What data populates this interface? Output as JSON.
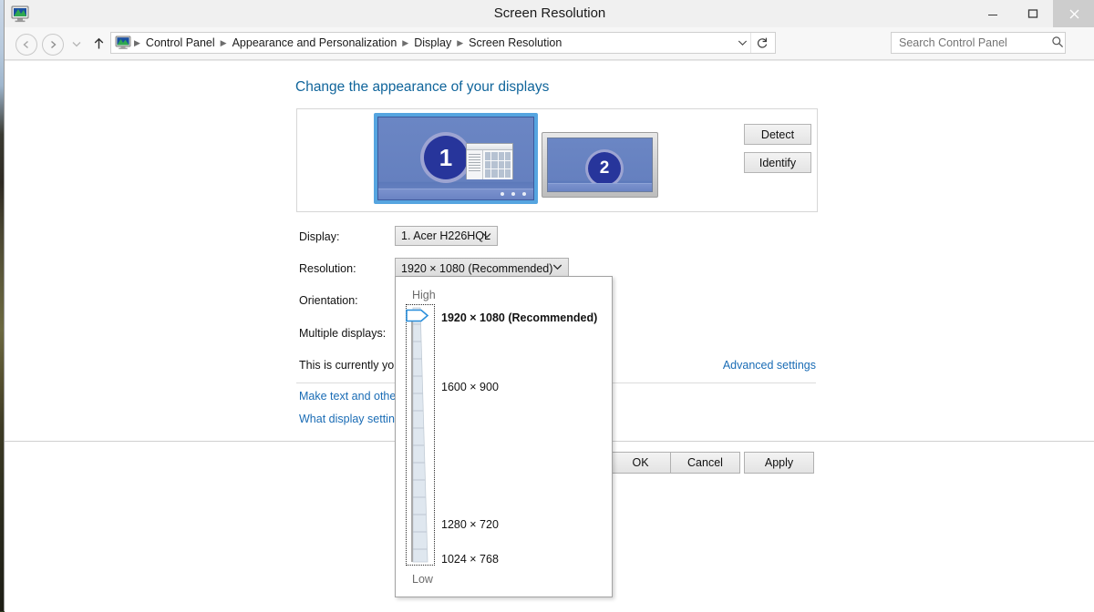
{
  "window": {
    "title": "Screen Resolution",
    "icon": "display-monitor-icon",
    "minimize_label": "Minimize",
    "maximize_label": "Maximize",
    "close_label": "Close"
  },
  "nav": {
    "back_label": "Back",
    "forward_label": "Forward",
    "recent_label": "Recent locations",
    "up_label": "Up one level",
    "breadcrumbs": [
      "Control Panel",
      "Appearance and Personalization",
      "Display",
      "Screen Resolution"
    ],
    "dropdown_label": "Previous locations",
    "refresh_label": "Refresh"
  },
  "search": {
    "placeholder": "Search Control Panel",
    "value": ""
  },
  "main": {
    "heading": "Change the appearance of your displays",
    "monitors": [
      {
        "number": "1",
        "selected": true
      },
      {
        "number": "2",
        "selected": false
      }
    ],
    "detect_label": "Detect",
    "identify_label": "Identify",
    "labels": {
      "display": "Display:",
      "resolution": "Resolution:",
      "orientation": "Orientation:",
      "multiple_displays": "Multiple displays:"
    },
    "display_value": "1. Acer H226HQL",
    "resolution_value": "1920 × 1080 (Recommended)",
    "currently_text": "This is currently your main display.",
    "advanced_settings_label": "Advanced settings",
    "links": [
      "Make text and other items larger or smaller",
      "What display settings should I choose?"
    ]
  },
  "resolution_popup": {
    "high_label": "High",
    "low_label": "Low",
    "options": [
      {
        "label": "1920 × 1080 (Recommended)",
        "selected": true
      },
      {
        "label": "1600 × 900",
        "selected": false
      },
      {
        "label": "1280 × 720",
        "selected": false
      },
      {
        "label": "1024 × 768",
        "selected": false
      }
    ]
  },
  "footer": {
    "ok_label": "OK",
    "cancel_label": "Cancel",
    "apply_label": "Apply"
  },
  "colors": {
    "accent_link": "#1a6cb5",
    "heading": "#10659b",
    "selected_monitor_border": "#56a5e0",
    "monitor_badge": "#27359b"
  }
}
